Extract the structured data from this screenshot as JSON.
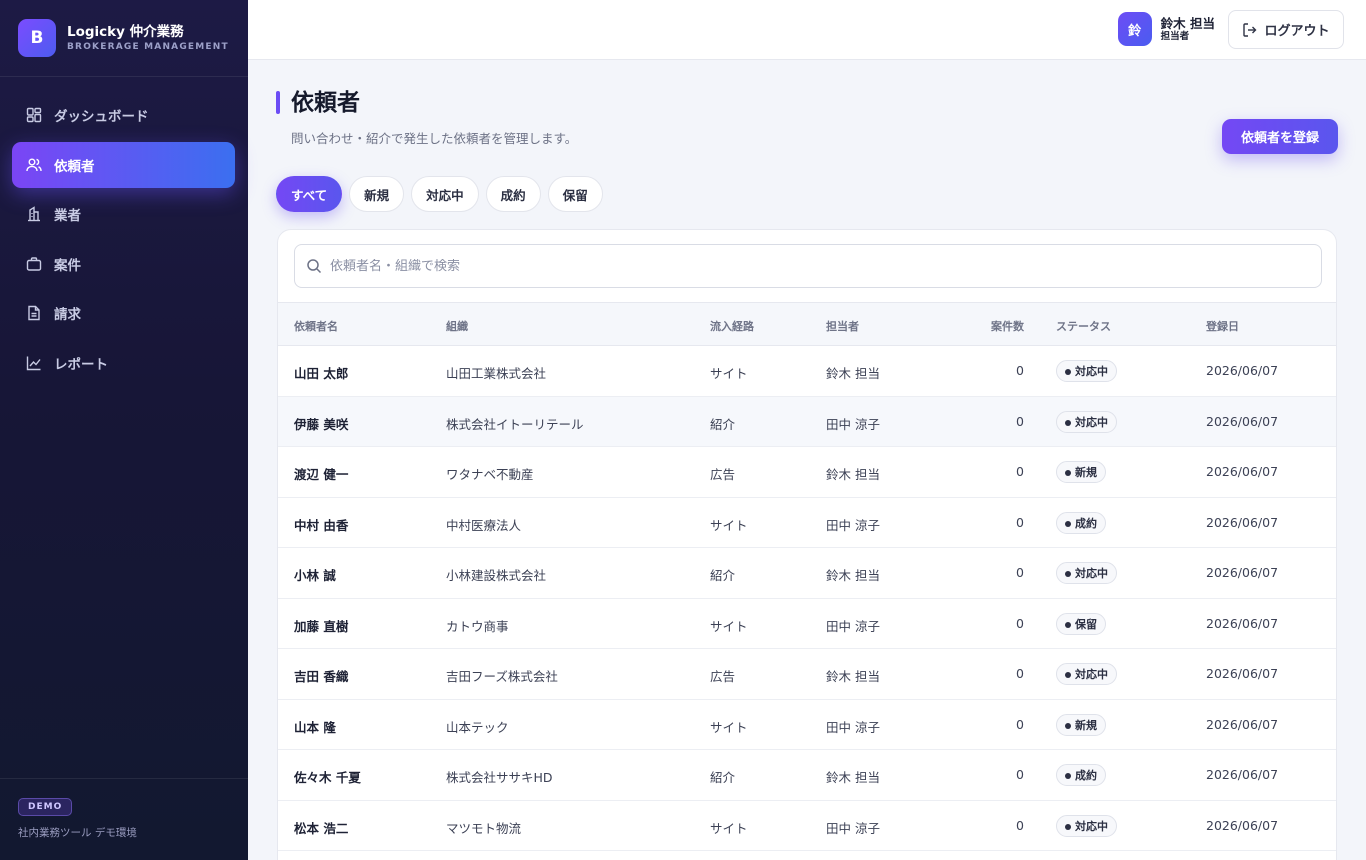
{
  "brand": {
    "logo": "B",
    "title": "Logicky 仲介業務",
    "subtitle": "BROKERAGE MANAGEMENT"
  },
  "sidebar": {
    "items": [
      {
        "label": "ダッシュボード",
        "icon": "dashboard-icon"
      },
      {
        "label": "依頼者",
        "icon": "users-icon",
        "active": true
      },
      {
        "label": "業者",
        "icon": "building-icon"
      },
      {
        "label": "案件",
        "icon": "briefcase-icon"
      },
      {
        "label": "請求",
        "icon": "invoice-icon"
      },
      {
        "label": "レポート",
        "icon": "chart-icon"
      }
    ],
    "demo_badge": "DEMO",
    "foot_note": "社内業務ツール デモ環境"
  },
  "header": {
    "avatar": "鈴",
    "user_name": "鈴木 担当",
    "user_role": "担当者",
    "logout_label": "ログアウト"
  },
  "page": {
    "title": "依頼者",
    "subtitle": "問い合わせ・紹介で発生した依頼者を管理します。",
    "register_label": "依頼者を登録"
  },
  "tabs": [
    {
      "label": "すべて",
      "active": true
    },
    {
      "label": "新規"
    },
    {
      "label": "対応中"
    },
    {
      "label": "成約"
    },
    {
      "label": "保留"
    }
  ],
  "search": {
    "placeholder": "依頼者名・組織で検索",
    "value": ""
  },
  "table": {
    "columns": [
      "依頼者名",
      "組織",
      "流入経路",
      "担当者",
      "案件数",
      "ステータス",
      "登録日"
    ],
    "rows": [
      {
        "name": "山田 太郎",
        "org": "山田工業株式会社",
        "source": "サイト",
        "owner": "鈴木 担当",
        "count": "0",
        "status": "対応中",
        "date": "2026/06/07"
      },
      {
        "name": "伊藤 美咲",
        "org": "株式会社イトーリテール",
        "source": "紹介",
        "owner": "田中 涼子",
        "count": "0",
        "status": "対応中",
        "date": "2026/06/07"
      },
      {
        "name": "渡辺 健一",
        "org": "ワタナベ不動産",
        "source": "広告",
        "owner": "鈴木 担当",
        "count": "0",
        "status": "新規",
        "date": "2026/06/07"
      },
      {
        "name": "中村 由香",
        "org": "中村医療法人",
        "source": "サイト",
        "owner": "田中 涼子",
        "count": "0",
        "status": "成約",
        "date": "2026/06/07"
      },
      {
        "name": "小林 誠",
        "org": "小林建設株式会社",
        "source": "紹介",
        "owner": "鈴木 担当",
        "count": "0",
        "status": "対応中",
        "date": "2026/06/07"
      },
      {
        "name": "加藤 直樹",
        "org": "カトウ商事",
        "source": "サイト",
        "owner": "田中 涼子",
        "count": "0",
        "status": "保留",
        "date": "2026/06/07"
      },
      {
        "name": "吉田 香織",
        "org": "吉田フーズ株式会社",
        "source": "広告",
        "owner": "鈴木 担当",
        "count": "0",
        "status": "対応中",
        "date": "2026/06/07"
      },
      {
        "name": "山本 隆",
        "org": "山本テック",
        "source": "サイト",
        "owner": "田中 涼子",
        "count": "0",
        "status": "新規",
        "date": "2026/06/07"
      },
      {
        "name": "佐々木 千夏",
        "org": "株式会社ササキHD",
        "source": "紹介",
        "owner": "鈴木 担当",
        "count": "0",
        "status": "成約",
        "date": "2026/06/07"
      },
      {
        "name": "松本 浩二",
        "org": "マツモト物流",
        "source": "サイト",
        "owner": "田中 涼子",
        "count": "0",
        "status": "対応中",
        "date": "2026/06/07"
      }
    ]
  },
  "colors": {
    "accent": "#6b4cf5",
    "sidebar_bg": "#1a1840",
    "active_gradient_end": "#3b6ff0"
  }
}
